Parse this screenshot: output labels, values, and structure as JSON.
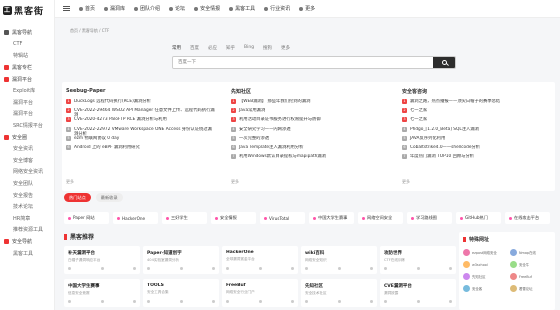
{
  "site": {
    "logo_mark": "工",
    "logo_text": "黑客街"
  },
  "sidebar": [
    {
      "label": "黑客导航",
      "sub": false,
      "color": "#555"
    },
    {
      "label": "CTF",
      "sub": true
    },
    {
      "label": "特辑站",
      "sub": true
    },
    {
      "label": "黑客专栏",
      "sub": false,
      "color": "#e33"
    },
    {
      "label": "漏洞平台",
      "sub": false,
      "color": "#e33"
    },
    {
      "label": "Exploit库",
      "sub": true
    },
    {
      "label": "漏洞平台",
      "sub": true
    },
    {
      "label": "漏洞平台",
      "sub": true
    },
    {
      "label": "SRC情报平台",
      "sub": true
    },
    {
      "label": "安全圈",
      "sub": false,
      "color": "#e33"
    },
    {
      "label": "安全资讯",
      "sub": true
    },
    {
      "label": "安全博客",
      "sub": true
    },
    {
      "label": "网络安全资讯",
      "sub": true
    },
    {
      "label": "安全团队",
      "sub": true
    },
    {
      "label": "安全报告",
      "sub": true
    },
    {
      "label": "技术论坛",
      "sub": true
    },
    {
      "label": "HR简章",
      "sub": true
    },
    {
      "label": "推荐资源工具",
      "sub": true
    },
    {
      "label": "安全导航",
      "sub": false,
      "color": "#e33"
    },
    {
      "label": "黑客工具",
      "sub": true
    }
  ],
  "topnav": [
    "首页",
    "漏洞库",
    "团队介绍",
    "论坛",
    "安全情报",
    "黑客工具",
    "行业资讯",
    "更多"
  ],
  "breadcrumb": "首页  /  黑客导航  /  CTF",
  "search": {
    "tabs": [
      "常用",
      "百度",
      "必应",
      "知乎",
      "Bing",
      "搜狗",
      "更多"
    ],
    "placeholder": "百度一下"
  },
  "panels": [
    {
      "title": "Seebug-Paper",
      "items": [
        "DuckLogs 远程代码执行(RCE)漏洞分析",
        "CVE-2022-29464 WSO2 API Manager 任意文件上传、远程代码执行漏洞",
        "CVE-2020-4273 PaloFTP RCE 漏洞分析与利用",
        "CVE-2022-22972 VMware Workspace ONE Access 身份认证绕过漏洞分析",
        "ezm 物联网协议 0 day",
        "Android 上的 eBPF 漏洞利用研究"
      ],
      "more": "更多"
    },
    {
      "title": "先知社区",
      "items": [
        "【WEB漏洞】 那些年我们挖到的漏洞",
        "Java常用漏洞",
        "利用活动目录证书服务进行权限提升与防御",
        "安全研究学习——内网渗透",
        "一次完整的渗透",
        "Java Template注入漏洞利用分析",
        "利用Windows默认目录提权与mapipath漏洞"
      ],
      "more": "更多"
    },
    {
      "title": "安全客咨询",
      "items": [
        "漏洞之路，热点播报——顶尖白帽子的赛季总结",
        "七一之家",
        "七一之家",
        "Phdgo_[1.2.0_Beta] SQL注入漏洞",
        "JAVA反序列化利用",
        "Cobaltstrike4.0——shellcode分析",
        "年度热门漏洞 TOP10 回顾与分析"
      ],
      "more": "更多"
    }
  ],
  "filter_tabs": [
    {
      "label": "热门站点",
      "active": true
    },
    {
      "label": "最新收录",
      "active": false
    }
  ],
  "quick": [
    "Paper 网站",
    "HackerOne",
    "三好学生",
    "安全情报",
    "VirusTotal",
    "中国大学生赛事",
    "网络空间安全",
    "学习路线图",
    "GitHub热门",
    "在线攻击平台"
  ],
  "section_title": "黑客推荐",
  "cards": [
    {
      "title": "补天漏洞平台",
      "desc": "白帽子漏洞响应平台"
    },
    {
      "title": "Paper-知道创宇",
      "desc": "404实验室漏洞分析"
    },
    {
      "title": "HackerOne",
      "desc": "全球漏洞赏金平台"
    },
    {
      "title": "wiki百科",
      "desc": "网络安全知识"
    },
    {
      "title": "攻防世界",
      "desc": "CTF在线训练"
    },
    {
      "title": "中国大学生赛事",
      "desc": "信息安全竞赛"
    },
    {
      "title": "TOOLS",
      "desc": "安全工具合集"
    },
    {
      "title": "FreeBuf",
      "desc": "网络安全行业门户"
    },
    {
      "title": "先知社区",
      "desc": "安全技术社区"
    },
    {
      "title": "CVE漏洞平台",
      "desc": "漏洞披露"
    }
  ],
  "friends": {
    "title": "特殊网址",
    "items": [
      {
        "label": "ezpost网络安全",
        "color": "#e7a"
      },
      {
        "label": "Nmap在线",
        "color": "#8ad"
      },
      {
        "label": "w3school",
        "color": "#fb6"
      },
      {
        "label": "安全牛",
        "color": "#9d8"
      },
      {
        "label": "先知社区",
        "color": "#c8e"
      },
      {
        "label": "FreeBuf",
        "color": "#e88"
      },
      {
        "label": "安全客",
        "color": "#7bd"
      },
      {
        "label": "看雪论坛",
        "color": "#db7"
      }
    ]
  }
}
